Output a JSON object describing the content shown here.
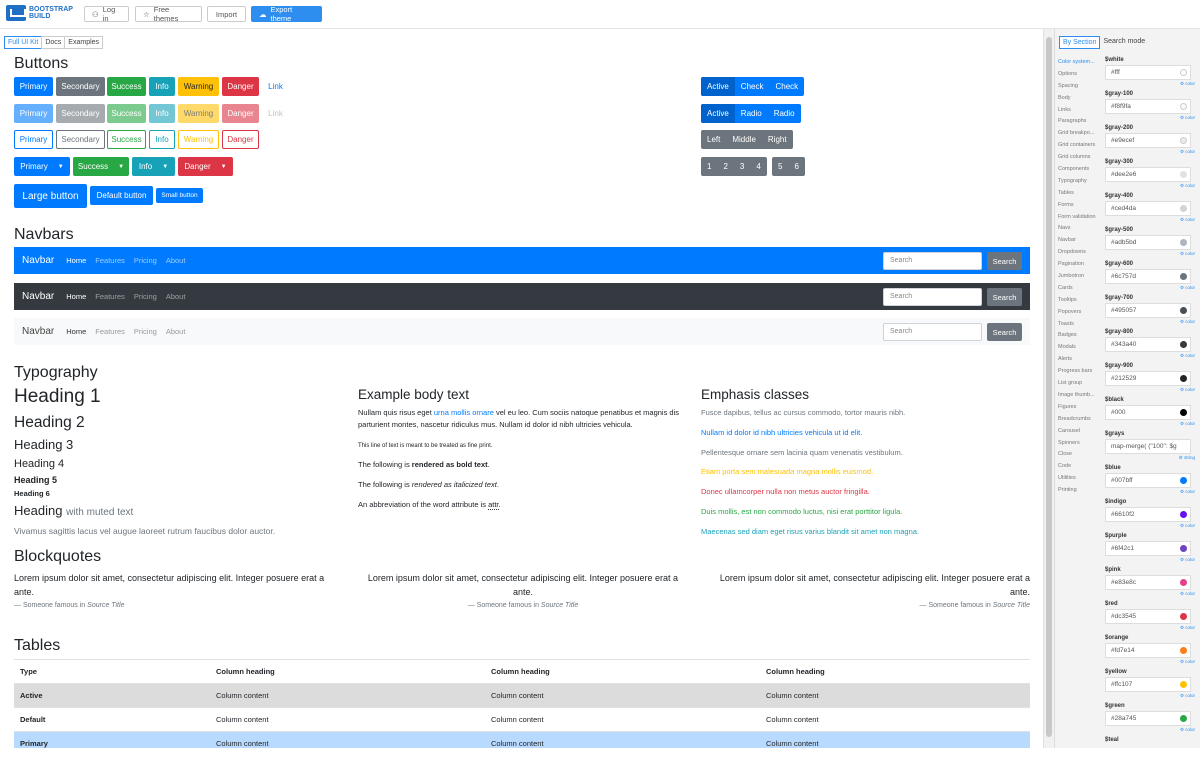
{
  "topbar": {
    "logo_line1": "BOOTSTRAP",
    "logo_line2": "BUILD",
    "login": "Log in",
    "free_themes": "Free themes",
    "import": "Import",
    "export": "Export theme"
  },
  "subnav": [
    "Full UI Kit",
    "Docs",
    "Examples"
  ],
  "sections": {
    "buttons": "Buttons",
    "navbars": "Navbars",
    "typography": "Typography",
    "blockquotes": "Blockquotes",
    "tables": "Tables"
  },
  "buttons": {
    "row": [
      "Primary",
      "Secondary",
      "Success",
      "Info",
      "Warning",
      "Danger",
      "Link"
    ],
    "dropdown": [
      "Primary",
      "Success",
      "Info",
      "Danger"
    ],
    "sizes": [
      "Large button",
      "Default button",
      "Small button"
    ],
    "check": [
      "Active",
      "Check",
      "Check"
    ],
    "radio": [
      "Active",
      "Radio",
      "Radio"
    ],
    "lmr": [
      "Left",
      "Middle",
      "Right"
    ],
    "pages1": [
      "1",
      "2",
      "3",
      "4"
    ],
    "pages2": [
      "5",
      "6"
    ]
  },
  "navbar": {
    "brand": "Navbar",
    "links": [
      "Home",
      "Features",
      "Pricing",
      "About"
    ],
    "search_placeholder": "Search",
    "search_button": "Search"
  },
  "typography": {
    "h1": "Heading 1",
    "h2": "Heading 2",
    "h3": "Heading 3",
    "h4": "Heading 4",
    "h5": "Heading 5",
    "h6": "Heading 6",
    "muted_main": "Heading",
    "muted_sub": "with muted text",
    "lead": "Vivamus sagittis lacus vel augue laoreet rutrum faucibus dolor auctor."
  },
  "body_text": {
    "title": "Example body text",
    "p1a": "Nullam quis risus eget ",
    "p1link": "urna mollis ornare",
    "p1b": " vel eu leo. Cum sociis natoque penatibus et magnis dis parturient montes, nascetur ridiculus mus. Nullam id dolor id nibh ultricies vehicula.",
    "fine": "This line of text is meant to be treated as fine print.",
    "bold_pre": "The following is ",
    "bold": "rendered as bold text",
    "ital_pre": "The following is ",
    "ital": "rendered as italicized text",
    "abbr_pre": "An abbreviation of the word attribute is ",
    "abbr": "attr"
  },
  "emphasis": {
    "title": "Emphasis classes",
    "lines": [
      "Fusce dapibus, tellus ac cursus commodo, tortor mauris nibh.",
      "Nullam id dolor id nibh ultricies vehicula ut id elit.",
      "Pellentesque ornare sem lacinia quam venenatis vestibulum.",
      "Etiam porta sem malesuada magna mollis euismod.",
      "Donec ullamcorper nulla non metus auctor fringilla.",
      "Duis mollis, est non commodo luctus, nisi erat porttitor ligula.",
      "Maecenas sed diam eget risus varius blandit sit amet non magna."
    ],
    "colors": [
      "#6c757d",
      "#007bff",
      "#6c757d",
      "#ffc107",
      "#dc3545",
      "#28a745",
      "#17a2b8"
    ]
  },
  "blockquote": {
    "text": "Lorem ipsum dolor sit amet, consectetur adipiscing elit. Integer posuere erat a ante.",
    "footer": "— Someone famous in ",
    "source": "Source Title"
  },
  "table": {
    "headers": [
      "Type",
      "Column heading",
      "Column heading",
      "Column heading"
    ],
    "rows": [
      [
        "Active",
        "Column content",
        "Column content",
        "Column content"
      ],
      [
        "Default",
        "Column content",
        "Column content",
        "Column content"
      ],
      [
        "Primary",
        "Column content",
        "Column content",
        "Column content"
      ]
    ]
  },
  "panel": {
    "tabs": [
      "By Section",
      "Search mode"
    ],
    "sections": [
      "Color system...",
      "Options",
      "Spacing",
      "Body",
      "Links",
      "Paragraphs",
      "Grid breakpo...",
      "Grid containers",
      "Grid columns",
      "Components",
      "Typography",
      "Tables",
      "Forms",
      "Form validation",
      "Navs",
      "Navbar",
      "Dropdowns",
      "Pagination",
      "Jumbotron",
      "Cards",
      "Tooltips",
      "Popovers",
      "Toasts",
      "Badges",
      "Modals",
      "Alerts",
      "Progress bars",
      "List group",
      "Image thumb...",
      "Figures",
      "Breadcrumbs",
      "Carousel",
      "Spinners",
      "Close",
      "Code",
      "Utilities",
      "Printing"
    ],
    "color_link": "color",
    "string_link": "string",
    "vars": [
      {
        "name": "$white",
        "value": "#fff",
        "color": "#ffffff"
      },
      {
        "name": "$gray-100",
        "value": "#f8f9fa",
        "color": "#f8f9fa"
      },
      {
        "name": "$gray-200",
        "value": "#e9ecef",
        "color": "#e9ecef"
      },
      {
        "name": "$gray-300",
        "value": "#dee2e6",
        "color": "#dee2e6"
      },
      {
        "name": "$gray-400",
        "value": "#ced4da",
        "color": "#ced4da"
      },
      {
        "name": "$gray-500",
        "value": "#adb5bd",
        "color": "#adb5bd"
      },
      {
        "name": "$gray-600",
        "value": "#6c757d",
        "color": "#6c757d"
      },
      {
        "name": "$gray-700",
        "value": "#495057",
        "color": "#495057"
      },
      {
        "name": "$gray-800",
        "value": "#343a40",
        "color": "#343a40"
      },
      {
        "name": "$gray-900",
        "value": "#212529",
        "color": "#212529"
      },
      {
        "name": "$black",
        "value": "#000",
        "color": "#000000"
      },
      {
        "name": "$grays",
        "value": "map-merge( (\"100\": $g",
        "color": ""
      },
      {
        "name": "$blue",
        "value": "#007bff",
        "color": "#007bff"
      },
      {
        "name": "$indigo",
        "value": "#6610f2",
        "color": "#6610f2"
      },
      {
        "name": "$purple",
        "value": "#6f42c1",
        "color": "#6f42c1"
      },
      {
        "name": "$pink",
        "value": "#e83e8c",
        "color": "#e83e8c"
      },
      {
        "name": "$red",
        "value": "#dc3545",
        "color": "#dc3545"
      },
      {
        "name": "$orange",
        "value": "#fd7e14",
        "color": "#fd7e14"
      },
      {
        "name": "$yellow",
        "value": "#ffc107",
        "color": "#ffc107"
      },
      {
        "name": "$green",
        "value": "#28a745",
        "color": "#28a745"
      },
      {
        "name": "$teal",
        "value": "",
        "color": ""
      }
    ]
  }
}
